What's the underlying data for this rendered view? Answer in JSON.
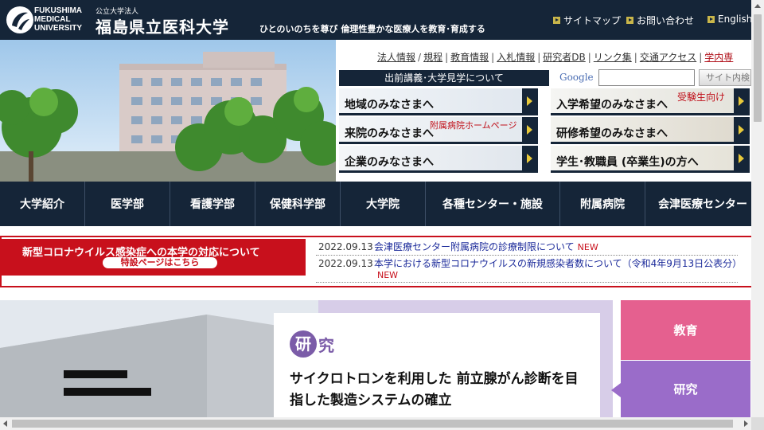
{
  "header": {
    "logo_en_1": "FUKUSHIMA",
    "logo_en_2": "MEDICAL",
    "logo_en_3": "UNIVERSITY",
    "corp_type": "公立大学法人",
    "uni_name": "福島県立医科大学",
    "tagline": "ひとのいのちを尊び 倫理性豊かな医療人を教育･育成する",
    "links": [
      "サイトマップ",
      "お問い合わせ",
      "English"
    ]
  },
  "util_links": [
    "法人情報",
    "規程",
    "教育情報",
    "入札情報",
    "研究者DB",
    "リンク集",
    "交通アクセス"
  ],
  "util_link_red": "学内専",
  "lecture_banner": "出前講義･大学見学について",
  "search": {
    "google_label": "Google",
    "button_label": "サイト内検"
  },
  "visitor_buttons": [
    {
      "label": "地域のみなさまへ"
    },
    {
      "label": "入学希望のみなさまへ",
      "note": "受験生向け"
    },
    {
      "label": "来院のみなさまへ",
      "note": "附属病院ホームページ"
    },
    {
      "label": "研修希望のみなさまへ"
    },
    {
      "label": "企業のみなさまへ"
    },
    {
      "label": "学生･教職員 (卒業生)の方へ"
    }
  ],
  "main_nav": [
    "大学紹介",
    "医学部",
    "看護学部",
    "保健科学部",
    "大学院",
    "各種センター・施設",
    "附属病院",
    "会津医療センター"
  ],
  "corona": {
    "title": "新型コロナウイルス感染症への本学の対応について",
    "sub": "特設ページはこちら"
  },
  "news": [
    {
      "date": "2022.09.13",
      "title": "会津医療センター附属病院の診療制限について",
      "new": "NEW"
    },
    {
      "date": "2022.09.13",
      "title": "本学における新型コロナウイルスの新規感染者数について（令和4年9月13日公表分）",
      "new": "NEW"
    }
  ],
  "feature": {
    "category_first": "研",
    "category_rest": "究",
    "headline": "サイクロトロンを利用した 前立腺がん診断を目指した製造システムの確立"
  },
  "side_tabs": [
    "教育",
    "研究"
  ],
  "colors": {
    "navy": "#152538",
    "red": "#c8101c",
    "pink": "#e5608f",
    "purple": "#9a6cc9",
    "lavender": "#d7cde8"
  }
}
